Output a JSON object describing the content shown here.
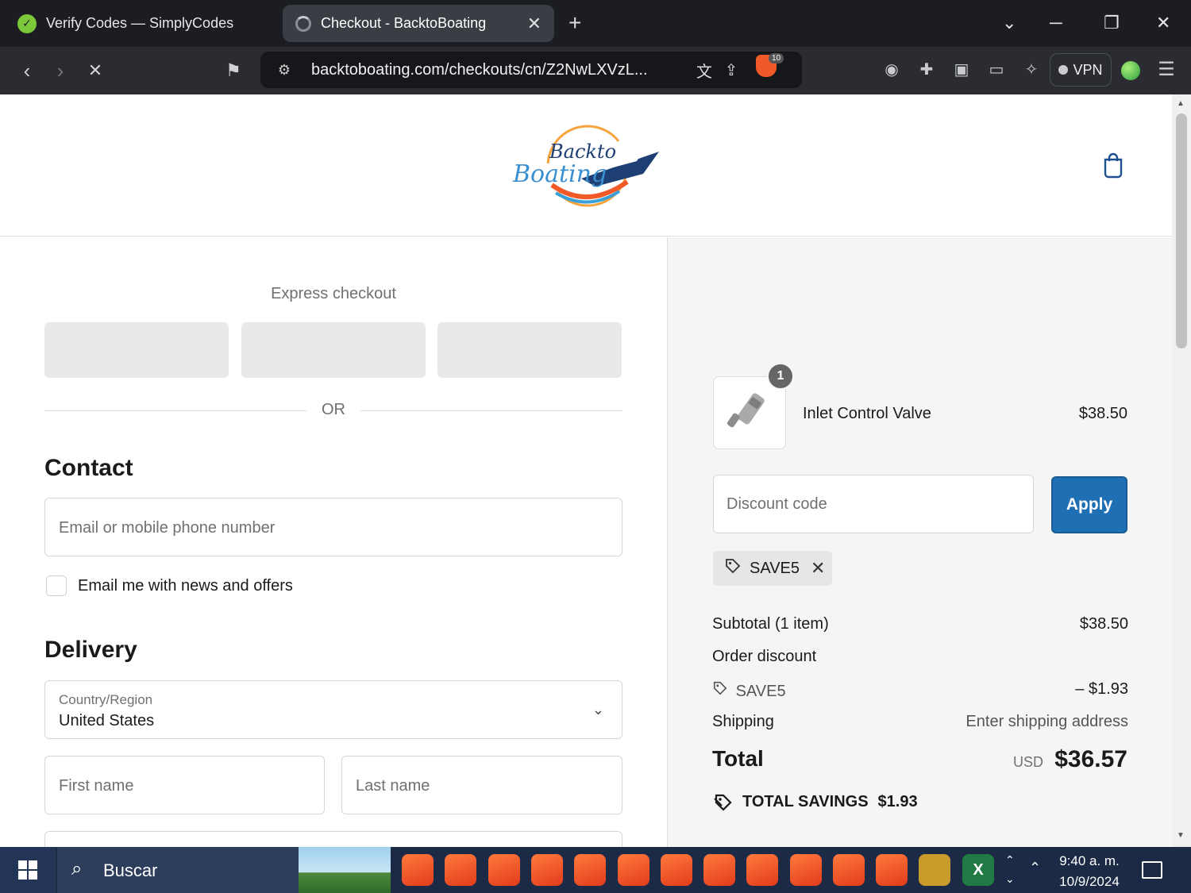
{
  "browser": {
    "tabs": [
      {
        "title": "Verify Codes — SimplyCodes",
        "active": false
      },
      {
        "title": "Checkout - BacktoBoating",
        "active": true
      }
    ],
    "url": "backtoboating.com/checkouts/cn/Z2NwLXVzL...",
    "shield_badge": "10",
    "vpn_label": "VPN"
  },
  "checkout": {
    "logo_text_1": "Backto",
    "logo_text_2": "Boating",
    "express_title": "Express checkout",
    "or_text": "OR",
    "contact": {
      "heading": "Contact",
      "email_placeholder": "Email or mobile phone number",
      "news_label": "Email me with news and offers",
      "news_checked": false
    },
    "delivery": {
      "heading": "Delivery",
      "country_label": "Country/Region",
      "country_value": "United States",
      "first_name_placeholder": "First name",
      "last_name_placeholder": "Last name"
    }
  },
  "summary": {
    "item": {
      "name": "Inlet Control Valve",
      "price": "$38.50",
      "quantity": "1"
    },
    "discount_placeholder": "Discount code",
    "apply_label": "Apply",
    "applied_code": "SAVE5",
    "subtotal_label": "Subtotal (1 item)",
    "subtotal_value": "$38.50",
    "order_discount_label": "Order discount",
    "discount_code_label": "SAVE5",
    "discount_value": "– $1.93",
    "shipping_label": "Shipping",
    "shipping_value": "Enter shipping address",
    "total_label": "Total",
    "currency": "USD",
    "total_value": "$36.57",
    "savings_label": "TOTAL SAVINGS",
    "savings_value": "$1.93"
  },
  "taskbar": {
    "search_label": "Buscar",
    "time": "9:40 a. m.",
    "date": "10/9/2024"
  },
  "colors": {
    "apply_button": "#1f6fb5",
    "summary_bg": "#f5f5f5",
    "taskbar": "#1c2a45"
  }
}
